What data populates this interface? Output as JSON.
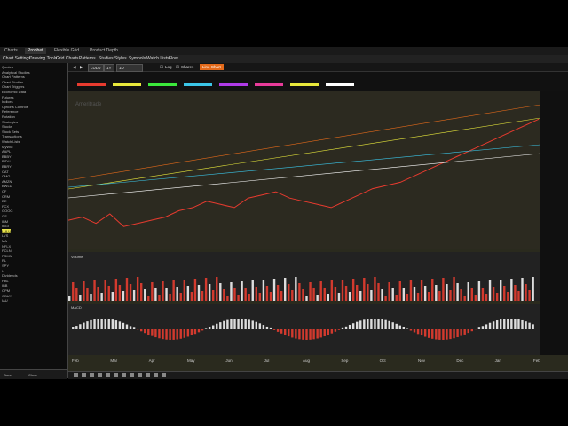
{
  "tabs": [
    "Charts",
    "Prophet",
    "Flexible Grid",
    "Product Depth"
  ],
  "menu": [
    "Chart Settings",
    "Drawing Tools",
    "Grid Charts",
    "Patterns",
    "Studies",
    "Styles",
    "Symbols",
    "Watch Lists",
    "Flow"
  ],
  "left_panel": {
    "items": [
      "Quotes",
      "Analytical Studies",
      "Chart Patterns",
      "Chart Studies",
      "Chart Triggers",
      "Economic Data",
      "Futures",
      "Indices",
      "Options Controls",
      "Reference",
      "Rotation",
      "Strategies",
      "Stocks",
      "Stock Sets",
      "Transactions",
      "Watch Lists",
      "MyWM",
      "AAPL",
      "BBBY",
      "BIDU",
      "BBRY",
      "CAT",
      "CMG",
      "AMZN",
      "BWLD",
      "CF",
      "CRM",
      "DE",
      "FCX",
      "GOOG",
      "GS",
      "IBM",
      "IBGI",
      "LULU",
      "LVS",
      "MA",
      "NFLX",
      "PCLN",
      "PSMN",
      "RL",
      "SPY",
      "V",
      "Dividends",
      "HBL",
      "IBB",
      "OPM",
      "GBUY",
      "IAU"
    ],
    "highlighted": "LULU",
    "footer": [
      "Save",
      "Close"
    ]
  },
  "chart_tools": {
    "symbol": "LULU",
    "period": "1Y",
    "interval": "1D",
    "log_label": "Log",
    "shares_label": "Shares",
    "line_button": "Line Chart"
  },
  "studies_colors": [
    "#e83b2f",
    "#e8e83b",
    "#3be83b",
    "#3bc6e8",
    "#b03be8",
    "#e83b9a",
    "#e8e83b",
    "#ffffff"
  ],
  "chart_watermark": "Ameritrade",
  "accent_color": "#e46a1a",
  "chart_data": {
    "type": "line",
    "panels": [
      "price",
      "volume",
      "oscillator"
    ],
    "volume_label": "Volume",
    "oscillator_label": "MACD",
    "x_tick_labels": [
      "Feb",
      "Mar",
      "Apr",
      "May",
      "Jun",
      "Jul",
      "Aug",
      "Sep",
      "Oct",
      "Nov",
      "Dec",
      "Jan",
      "Feb"
    ],
    "price_series": [
      62,
      63,
      61,
      64,
      60,
      61,
      62,
      63,
      65,
      66,
      68,
      67,
      66,
      69,
      70,
      71,
      69,
      68,
      67,
      66,
      68,
      70,
      72,
      73,
      74,
      76,
      78,
      80,
      82,
      84,
      86,
      88,
      90,
      92,
      94
    ]
  }
}
